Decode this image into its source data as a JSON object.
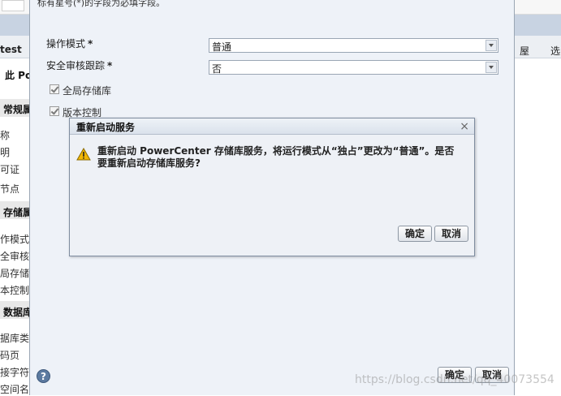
{
  "background": {
    "tab_test": "test",
    "header_po": "此 Po",
    "tab_right1": "屋",
    "tab_right2": "选",
    "section_general": "常规属",
    "general_items": [
      "称",
      "明",
      "可证",
      "节点"
    ],
    "section_repo": "存储属",
    "repo_items": [
      "作模式",
      "全审核跟",
      "局存储库",
      "本控制"
    ],
    "section_db": "数据库",
    "db_items": [
      "据库类型",
      "码页",
      "接字符",
      "空间名称"
    ]
  },
  "edit_dialog": {
    "required_note": "标有星号(*)的字段为必填字段。",
    "operating_mode_label": "操作模式",
    "operating_mode_value": "普通",
    "security_audit_label": "安全审核跟踪",
    "security_audit_value": "否",
    "required_star": "*",
    "global_repo_label": "全局存储库",
    "version_control_label": "版本控制",
    "help_label": "?",
    "ok_label": "确定",
    "cancel_label": "取消"
  },
  "confirm_dialog": {
    "title": "重新启动服务",
    "close_label": "×",
    "message": "重新启动 PowerCenter 存储库服务，将运行模式从“独占”更改为“普通”。是否要重新启动存储库服务?",
    "ok_label": "确定",
    "cancel_label": "取消"
  },
  "watermark": "https://blog.csdn.net/qq_40073554",
  "colors": {
    "dialog_bg": "#eef2f8",
    "band_blue": "#c8d3e2",
    "warning": "#f2b705"
  }
}
